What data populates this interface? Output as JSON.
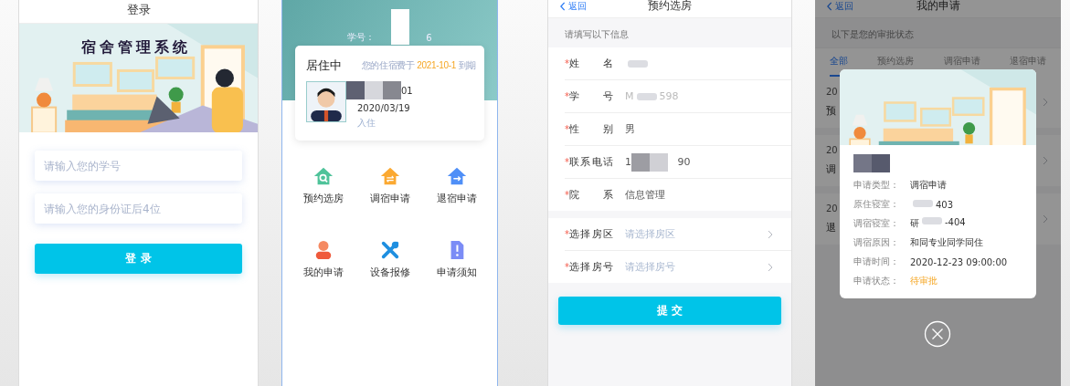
{
  "login_screen": {
    "title": "登录",
    "banner_title": "宿舍管理系统",
    "fields": [
      {
        "placeholder": "请输入您的学号"
      },
      {
        "placeholder": "请输入您的身份证后4位"
      }
    ],
    "button": "登 录"
  },
  "home_screen": {
    "student_id_label": "学号：",
    "student_id_end": "6",
    "status": "居住中",
    "expiry_prefix": "您的住宿费于 ",
    "expiry_date": "2021-10-1",
    "expiry_suffix": " 到期",
    "room_end": "01",
    "checkin_date": "2020/03/19",
    "checkin_label": "入住",
    "menu": [
      {
        "label": "预约选房",
        "kind": "search"
      },
      {
        "label": "调宿申请",
        "kind": "swap"
      },
      {
        "label": "退宿申请",
        "kind": "exit"
      },
      {
        "label": "我的申请",
        "kind": "person"
      },
      {
        "label": "设备报修",
        "kind": "wrench"
      },
      {
        "label": "申请须知",
        "kind": "notice"
      }
    ]
  },
  "reserve_screen": {
    "back": "返回",
    "title": "预约选房",
    "hint": "请填写以下信息",
    "required_mark": "*",
    "info_rows": [
      {
        "label": "姓名",
        "required": true,
        "value": [
          {
            "kind": "smudge"
          }
        ]
      },
      {
        "label": "学号",
        "required": true,
        "value": [
          {
            "kind": "faint",
            "text": "M"
          },
          {
            "kind": "smudge"
          },
          {
            "kind": "faint",
            "text": "598"
          }
        ]
      },
      {
        "label": "性别",
        "required": true,
        "value": [
          {
            "kind": "text",
            "text": "男"
          }
        ]
      },
      {
        "label": "联系电话",
        "required": true,
        "value": [
          {
            "kind": "text",
            "text": "1"
          },
          {
            "kind": "dark"
          },
          {
            "kind": "light"
          },
          {
            "kind": "text",
            "text": "   90"
          }
        ]
      },
      {
        "label": "院系",
        "required": true,
        "value": [
          {
            "kind": "text",
            "text": "信息管理"
          }
        ]
      }
    ],
    "select_rows": [
      {
        "label": "选择房区",
        "required": true,
        "placeholder": "请选择房区"
      },
      {
        "label": "选择房号",
        "required": true,
        "placeholder": "请选择房号"
      }
    ],
    "button": "提 交"
  },
  "applications_screen": {
    "back": "返回",
    "title": "我的申请",
    "hint": "以下是您的审批状态",
    "tabs": [
      {
        "label": "全部",
        "selected": true
      },
      {
        "label": "预约选房",
        "selected": false
      },
      {
        "label": "调宿申请",
        "selected": false
      },
      {
        "label": "退宿申请",
        "selected": false
      }
    ],
    "items": [
      {
        "date": "20",
        "type": "预"
      },
      {
        "date": "20",
        "type": "调"
      },
      {
        "date": "20",
        "type": "退"
      }
    ],
    "dialog": {
      "rows": [
        {
          "label": "申请类型：",
          "kind": "text",
          "value": [
            {
              "kind": "text",
              "text": "调宿申请"
            }
          ]
        },
        {
          "label": "原住寝室：",
          "kind": "text",
          "value": [
            {
              "kind": "smudge"
            },
            {
              "kind": "text",
              "text": "403"
            }
          ]
        },
        {
          "label": "调宿寝室：",
          "kind": "text",
          "value": [
            {
              "kind": "text",
              "text": "研"
            },
            {
              "kind": "smudge"
            },
            {
              "kind": "text",
              "text": "-404"
            }
          ]
        },
        {
          "label": "调宿原因：",
          "kind": "text",
          "value": [
            {
              "kind": "text",
              "text": "和同专业同学同住"
            }
          ]
        },
        {
          "label": "申请时间：",
          "kind": "text",
          "value": [
            {
              "kind": "text",
              "text": "2020-12-23 09:00:00"
            }
          ]
        },
        {
          "label": "申请状态：",
          "kind": "status",
          "value": [
            {
              "kind": "text",
              "text": "待审批"
            }
          ]
        }
      ]
    }
  }
}
